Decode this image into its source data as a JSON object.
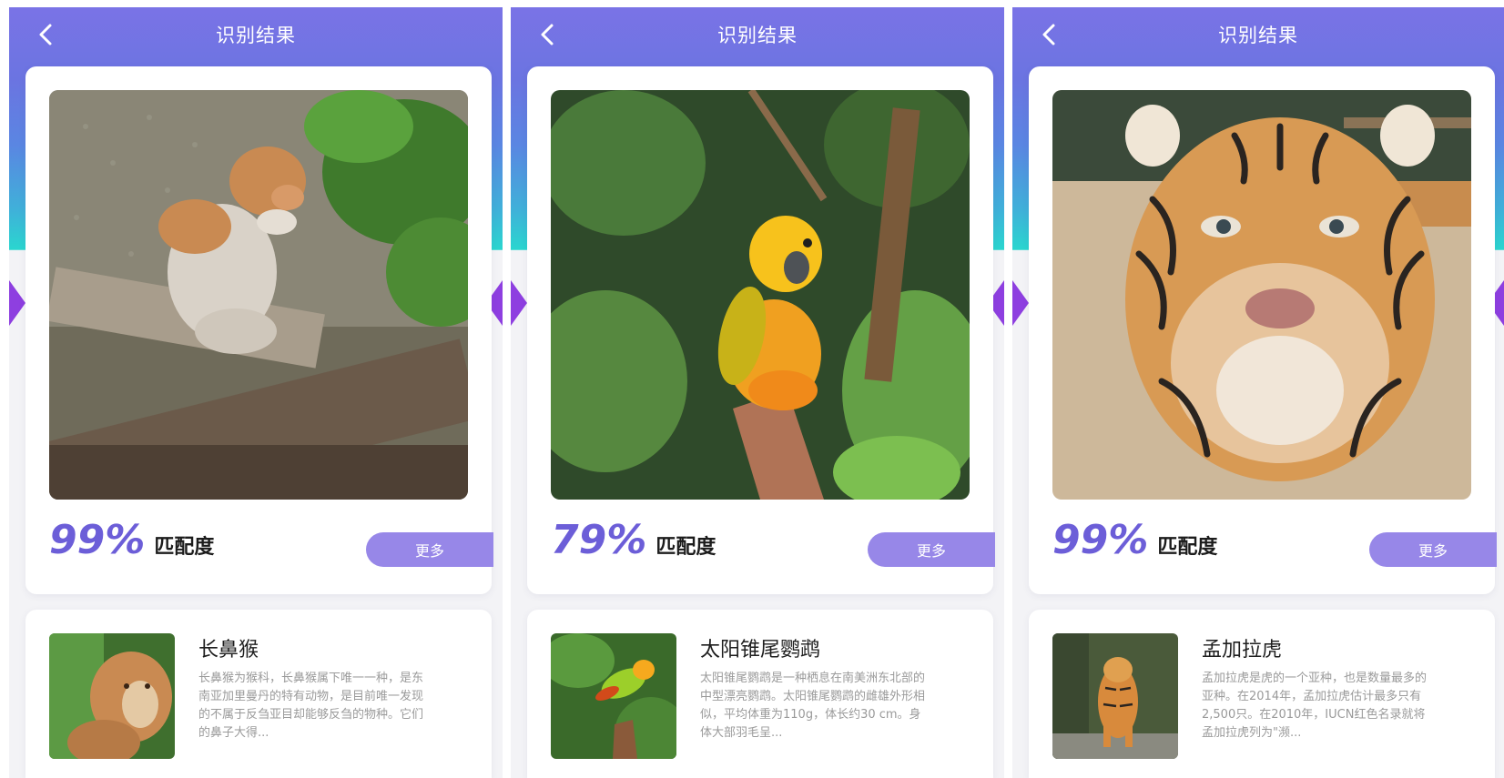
{
  "colors": {
    "accent": "#6c5ed8",
    "header_top": "#7a73e6",
    "header_bottom": "#2ad6cf",
    "button": "#9787e8",
    "page_bg": "#f3f3f6"
  },
  "screens": [
    {
      "header": {
        "title": "识别结果",
        "back_icon": "chevron-left-icon"
      },
      "result": {
        "photo_subject": "proboscis monkey",
        "match_percent": "99%",
        "match_label": "匹配度",
        "more_label": "更多"
      },
      "info": {
        "name": "长鼻猴",
        "description": "长鼻猴为猴科，长鼻猴属下唯一一种，是东南亚加里曼丹的特有动物，是目前唯一发现的不属于反刍亚目却能够反刍的物种。它们的鼻子大得..."
      }
    },
    {
      "header": {
        "title": "识别结果",
        "back_icon": "chevron-left-icon"
      },
      "result": {
        "photo_subject": "sun conure parrot",
        "match_percent": "79%",
        "match_label": "匹配度",
        "more_label": "更多"
      },
      "info": {
        "name": "太阳锥尾鹦鹉",
        "description": "太阳锥尾鹦鹉是一种栖息在南美洲东北部的中型漂亮鹦鹉。太阳锥尾鹦鹉的雌雄外形相似，平均体重为110g，体长约30 cm。身体大部羽毛呈..."
      }
    },
    {
      "header": {
        "title": "识别结果",
        "back_icon": "chevron-left-icon"
      },
      "result": {
        "photo_subject": "bengal tiger",
        "match_percent": "99%",
        "match_label": "匹配度",
        "more_label": "更多"
      },
      "info": {
        "name": "孟加拉虎",
        "description": "孟加拉虎是虎的一个亚种，也是数量最多的亚种。在2014年，孟加拉虎估计最多只有2,500只。在2010年，IUCN红色名录就将孟加拉虎列为\"濒..."
      }
    }
  ]
}
